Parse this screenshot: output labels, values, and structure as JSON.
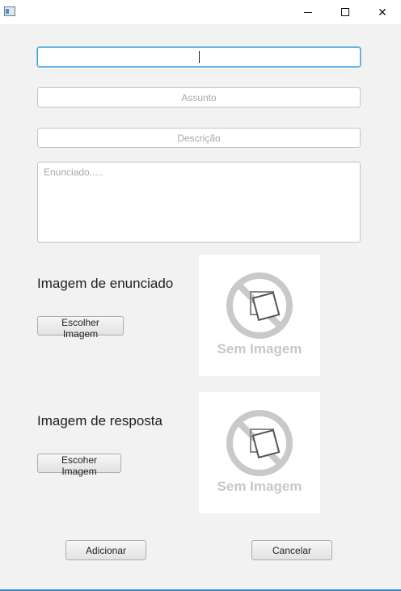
{
  "window": {
    "icon": "app-window-icon",
    "controls": {
      "minimize": "minimize-icon",
      "maximize": "maximize-icon",
      "close": "close-icon",
      "close_glyph": "✕"
    }
  },
  "form": {
    "title_value": "",
    "subject_placeholder": "Assunto",
    "description_placeholder": "Descrição",
    "statement_placeholder": "Enunciado....."
  },
  "statement_image": {
    "label": "Imagem de enunciado",
    "button_label": "Escolher Imagem",
    "placeholder_text": "Sem Imagem",
    "placeholder_icon": "no-image-icon"
  },
  "answer_image": {
    "label": "Imagem de resposta",
    "button_label": "Escoher Imagem",
    "placeholder_text": "Sem Imagem",
    "placeholder_icon": "no-image-icon"
  },
  "actions": {
    "add_label": "Adicionar",
    "cancel_label": "Cancelar"
  },
  "colors": {
    "focus_border": "#3d9ad6",
    "window_bg": "#f2f2f2",
    "placeholder_gray": "#c8c8c8",
    "bottom_accent": "#3a86c8"
  }
}
